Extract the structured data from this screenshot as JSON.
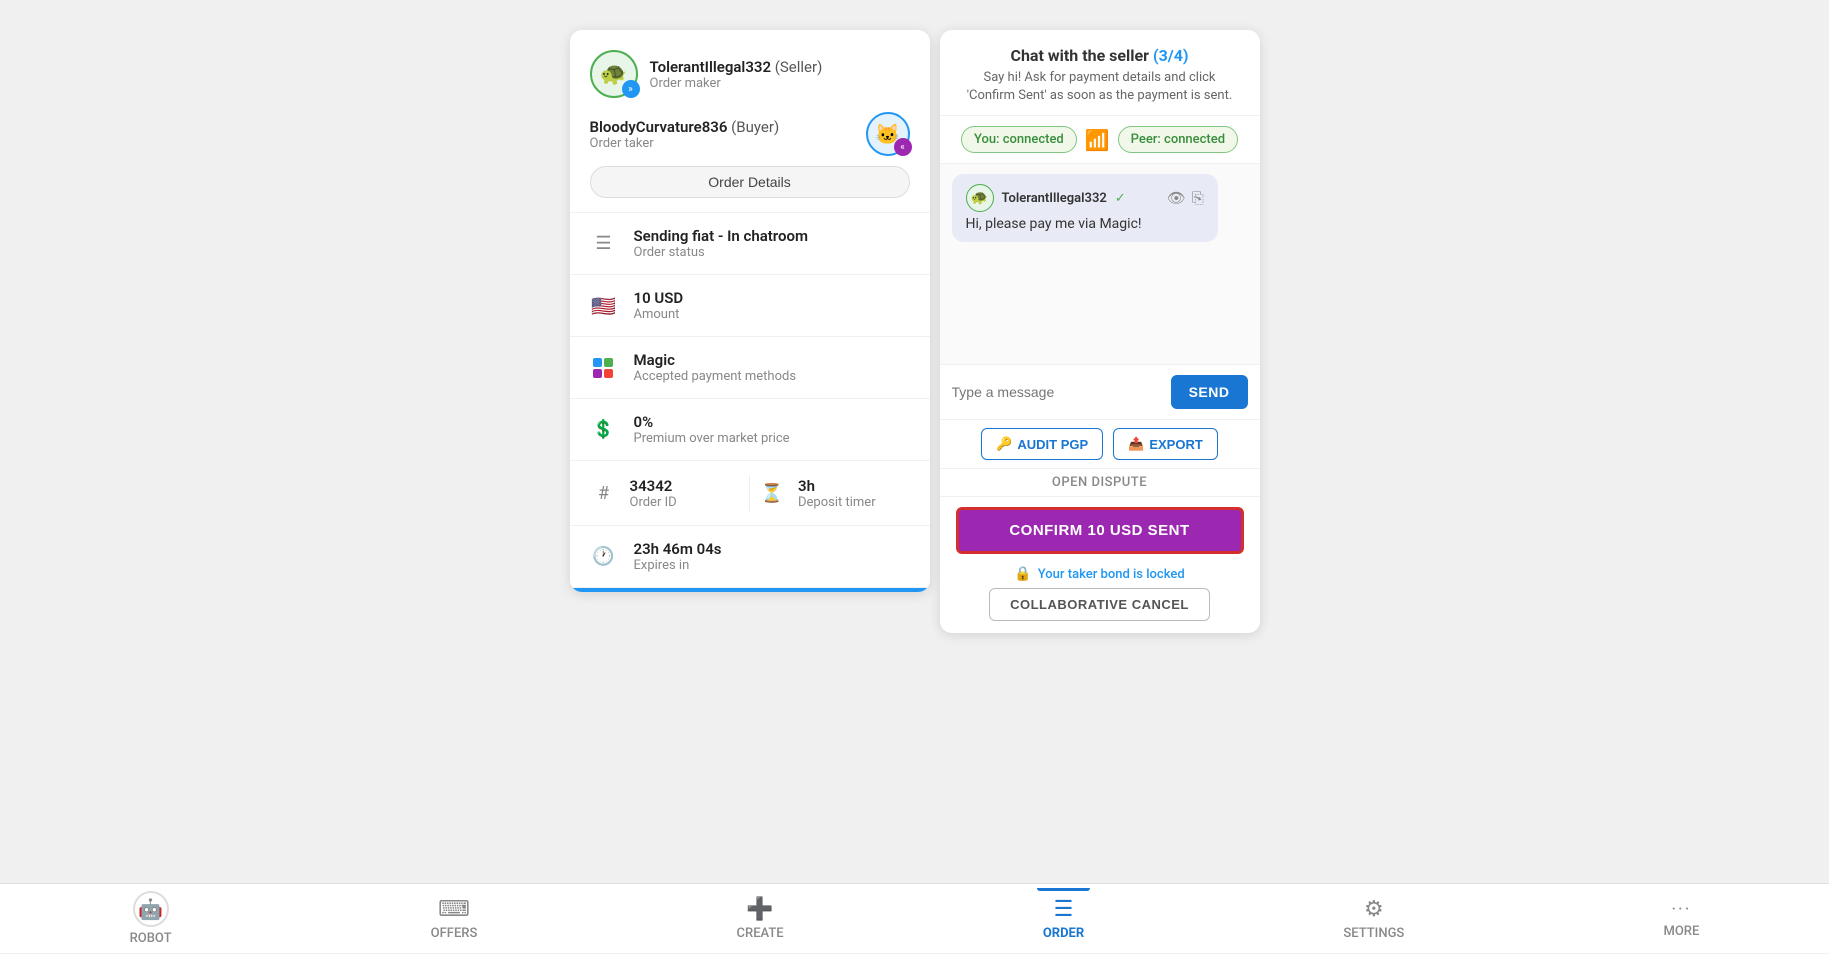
{
  "seller": {
    "name": "TolerantIllegal332",
    "role_label": "(Seller)",
    "sub_role": "Order maker",
    "avatar_emoji": "🐢"
  },
  "buyer": {
    "name": "BloodyCurvature836",
    "role_label": "(Buyer)",
    "sub_role": "Order taker",
    "avatar_emoji": "🐱"
  },
  "order_details_btn": "Order Details",
  "order_info": {
    "status": {
      "main": "Sending fiat - In chatroom",
      "sub": "Order status"
    },
    "amount": {
      "main": "10 USD",
      "sub": "Amount"
    },
    "payment": {
      "main": "Magic",
      "sub": "Accepted payment methods"
    },
    "premium": {
      "main": "0%",
      "sub": "Premium over market price"
    },
    "order_id": {
      "main": "34342",
      "sub": "Order ID"
    },
    "deposit_timer": {
      "main": "3h",
      "sub": "Deposit timer"
    },
    "expires": {
      "main": "23h 46m 04s",
      "sub": "Expires in"
    }
  },
  "chat": {
    "title": "Chat with the seller",
    "step": "(3/4)",
    "subtitle": "Say hi! Ask for payment details and click 'Confirm Sent' as soon as the payment is sent.",
    "you_status": "You: connected",
    "peer_status": "Peer: connected",
    "message": {
      "sender": "TolerantIllegal332",
      "text": "Hi, please pay me via Magic!",
      "avatar_emoji": "🐢"
    },
    "input_placeholder": "Type a message",
    "send_btn": "SEND",
    "audit_btn": "AUDIT PGP",
    "export_btn": "EXPORT",
    "open_dispute": "OPEN DISPUTE",
    "confirm_btn": "CONFIRM 10 USD SENT",
    "bond_locked": "Your taker bond is locked",
    "collab_cancel": "COLLABORATIVE CANCEL"
  },
  "nav": {
    "robot": "ROBOT",
    "offers": "OFFERS",
    "create": "CREATE",
    "order": "ORDER",
    "settings": "SETTINGS",
    "more": "MORE"
  },
  "progress": 100
}
